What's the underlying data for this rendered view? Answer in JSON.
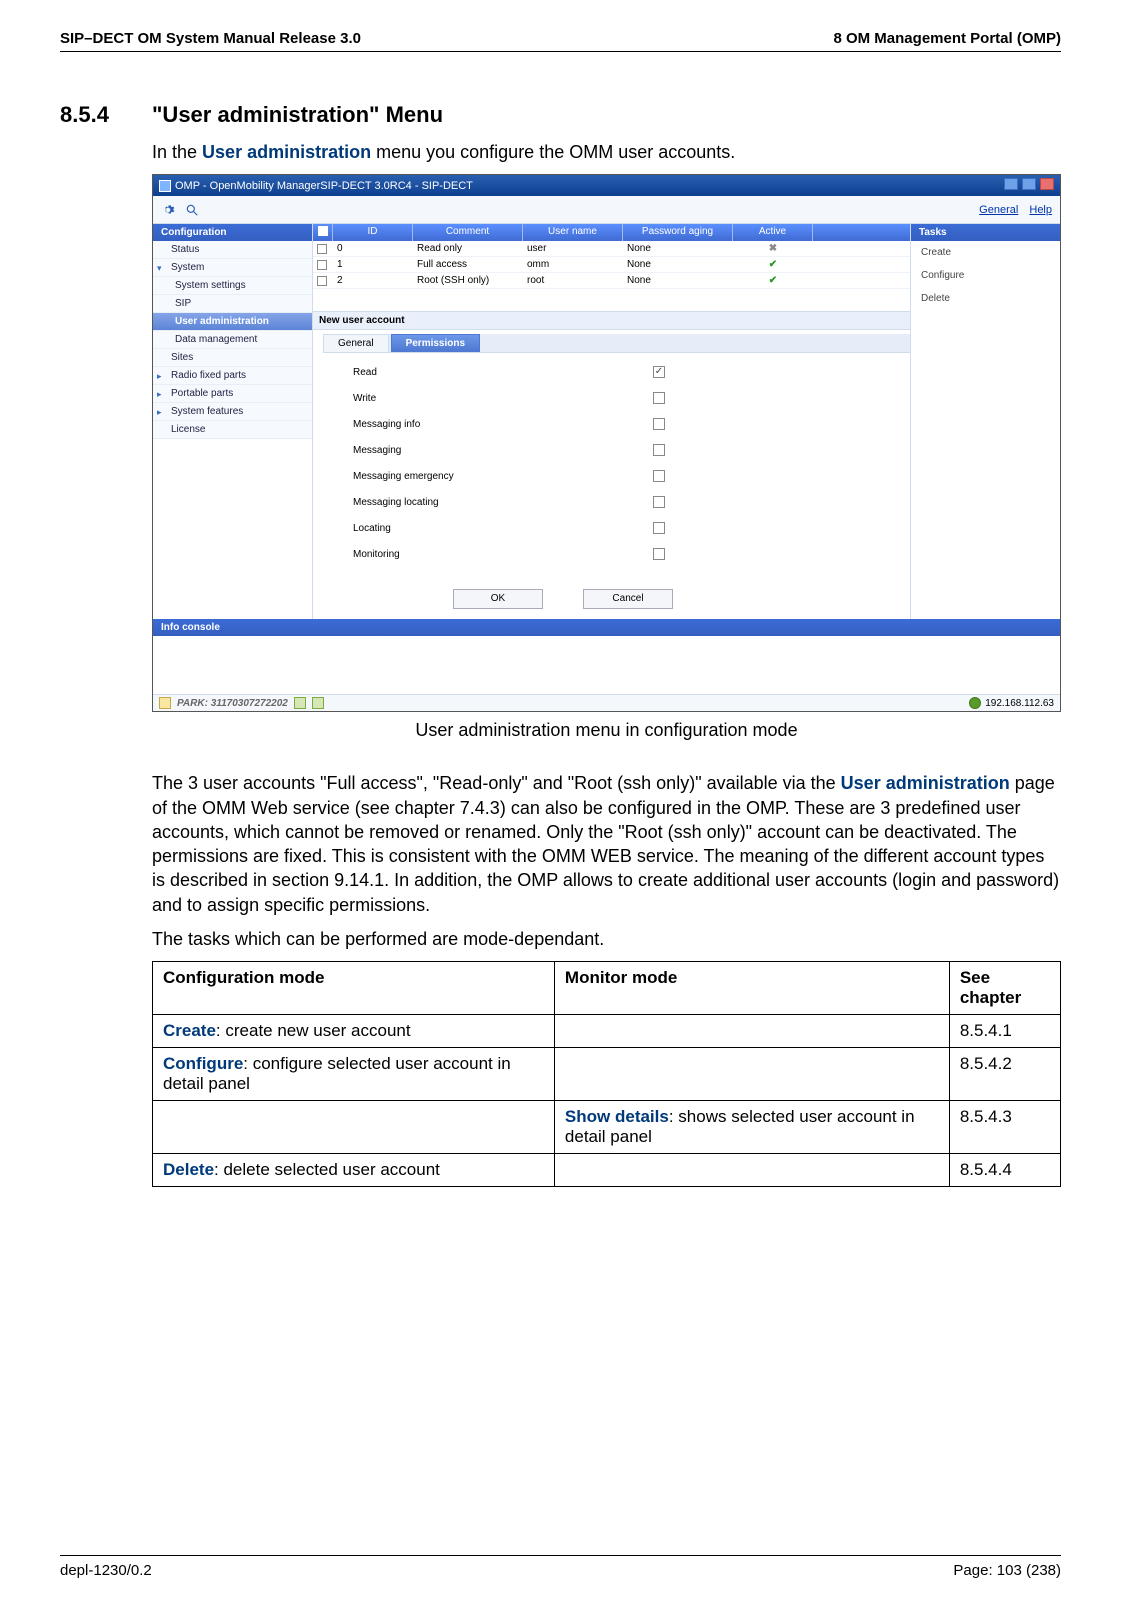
{
  "header": {
    "left": "SIP–DECT OM System Manual Release 3.0",
    "right": "8 OM Management Portal (OMP)"
  },
  "section": {
    "number": "8.5.4",
    "title": "\"User administration\" Menu"
  },
  "intro": {
    "prefix": "In the ",
    "link": "User administration",
    "suffix": " menu you configure the OMM user accounts."
  },
  "screenshot": {
    "window_title": "OMP - OpenMobility ManagerSIP-DECT 3.0RC4 - SIP-DECT",
    "general_link": "General",
    "help_link": "Help",
    "sidebar": {
      "heading": "Configuration",
      "items": [
        "Status",
        "System",
        "System settings",
        "SIP",
        "User administration",
        "Data management",
        "Sites",
        "Radio fixed parts",
        "Portable parts",
        "System features",
        "License"
      ]
    },
    "columns": [
      "ID",
      "Comment",
      "User name",
      "Password aging",
      "Active"
    ],
    "rows": [
      {
        "id": "0",
        "comment": "Read only",
        "username": "user",
        "pwaging": "None",
        "active": "x"
      },
      {
        "id": "1",
        "comment": "Full access",
        "username": "omm",
        "pwaging": "None",
        "active": "check"
      },
      {
        "id": "2",
        "comment": "Root (SSH only)",
        "username": "root",
        "pwaging": "None",
        "active": "check"
      }
    ],
    "tasks_heading": "Tasks",
    "tasks": [
      "Create",
      "Configure",
      "Delete"
    ],
    "newacc_title": "New user account",
    "tabs": {
      "general": "General",
      "permissions": "Permissions"
    },
    "permissions": [
      {
        "label": "Read",
        "checked": true
      },
      {
        "label": "Write",
        "checked": false
      },
      {
        "label": "Messaging info",
        "checked": false
      },
      {
        "label": "Messaging",
        "checked": false
      },
      {
        "label": "Messaging emergency",
        "checked": false
      },
      {
        "label": "Messaging locating",
        "checked": false
      },
      {
        "label": "Locating",
        "checked": false
      },
      {
        "label": "Monitoring",
        "checked": false
      }
    ],
    "buttons": {
      "ok": "OK",
      "cancel": "Cancel"
    },
    "info_console": "Info console",
    "status": {
      "park": "PARK: 31170307272202",
      "ip": "192.168.112.63"
    }
  },
  "figure_caption": "User administration menu in configuration mode",
  "para1": {
    "p1": "The 3 user accounts \"Full access\", \"Read-only\" and \"Root (ssh only)\" available via the ",
    "link": "User administration",
    "p2": " page of the OMM Web service (see chapter 7.4.3) can also be configured in the OMP. These are 3 predefined user accounts, which cannot be removed or renamed. Only the \"Root (ssh only)\" account can be deactivated. The permissions are fixed. This is consistent with the OMM WEB service. The meaning of the different account types is described in section 9.14.1. In addition, the OMP allows to create additional user accounts (login and password) and to assign specific permissions."
  },
  "para2": "The tasks which can be performed are mode-dependant.",
  "table": {
    "headers": [
      "Configuration mode",
      "Monitor mode",
      "See chapter"
    ],
    "rows": [
      {
        "kw": "Create",
        "config": ": create new user account",
        "monitor": "",
        "chap": "8.5.4.1"
      },
      {
        "kw": "Configure",
        "config": ": configure selected user account in detail panel",
        "monitor": "",
        "chap": "8.5.4.2"
      },
      {
        "kw": "",
        "config": "",
        "monitor_kw": "Show details",
        "monitor": ": shows selected user account in detail panel",
        "chap": "8.5.4.3"
      },
      {
        "kw": "Delete",
        "config": ": delete selected user account",
        "monitor": "",
        "chap": "8.5.4.4"
      }
    ]
  },
  "footer": {
    "left": "depl-1230/0.2",
    "right": "Page: 103 (238)"
  }
}
